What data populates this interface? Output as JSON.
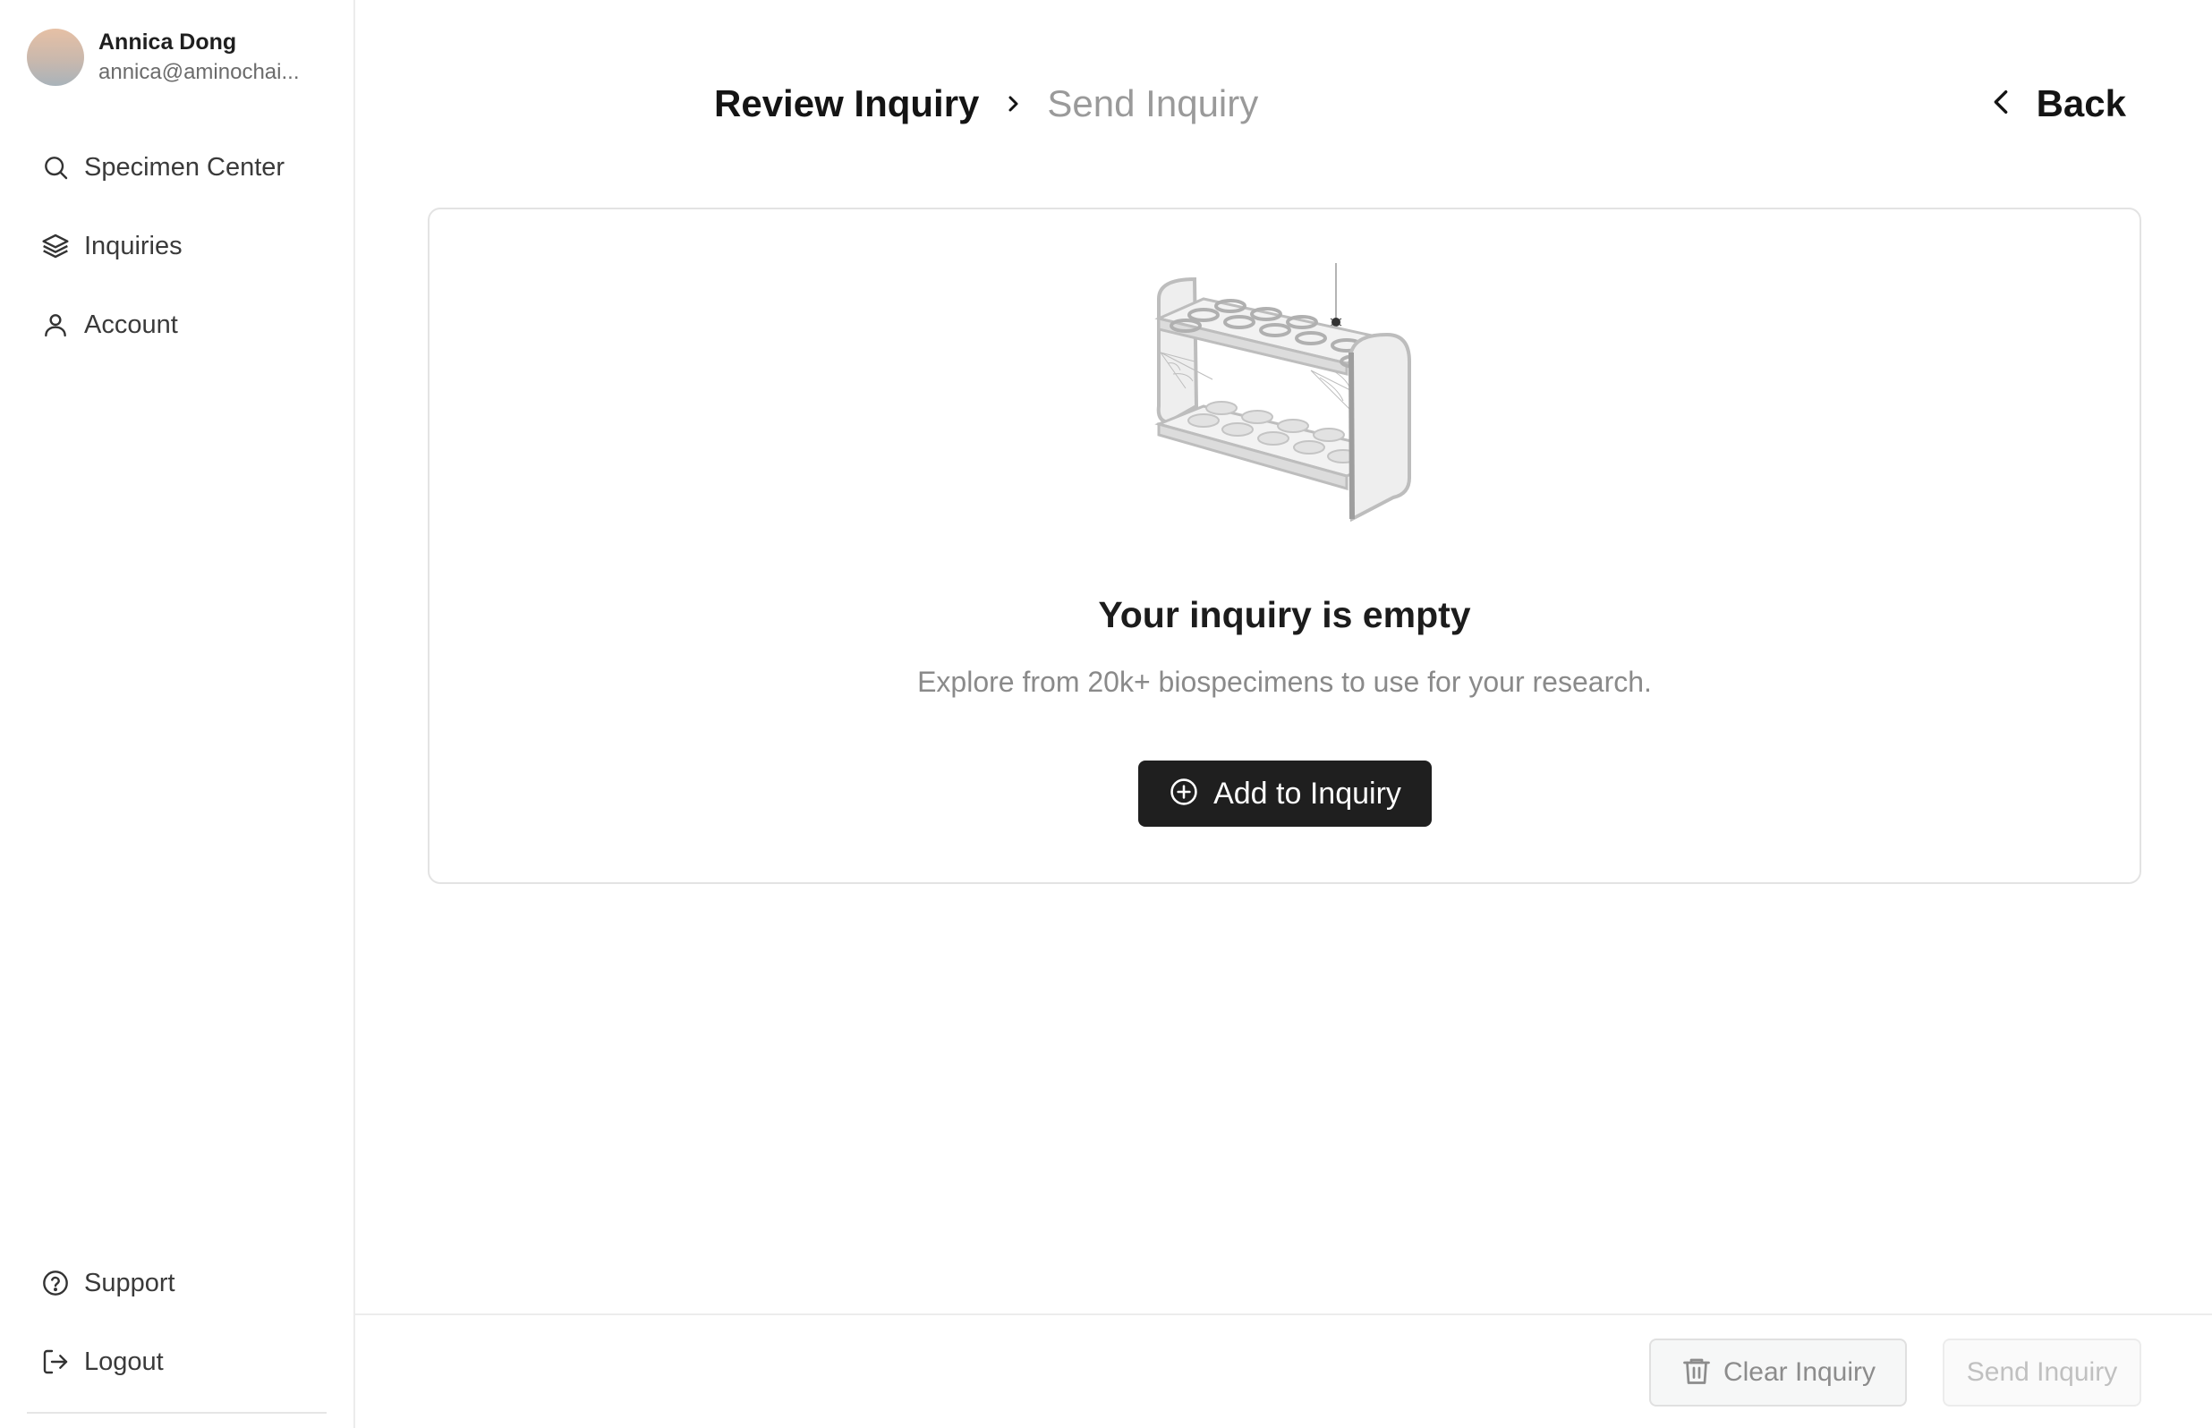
{
  "user": {
    "name": "Annica Dong",
    "email": "annica@aminochai..."
  },
  "sidebar": {
    "items": [
      {
        "label": "Specimen Center",
        "icon": "search-icon"
      },
      {
        "label": "Inquiries",
        "icon": "layers-icon"
      },
      {
        "label": "Account",
        "icon": "user-icon"
      }
    ],
    "bottom_items": [
      {
        "label": "Support",
        "icon": "help-circle-icon"
      },
      {
        "label": "Logout",
        "icon": "logout-icon"
      }
    ]
  },
  "header": {
    "breadcrumb_active": "Review Inquiry",
    "breadcrumb_inactive": "Send Inquiry",
    "back_label": "Back"
  },
  "empty_state": {
    "title": "Your inquiry is empty",
    "description": "Explore from 20k+ biospecimens to use for your research.",
    "button_label": "Add to Inquiry"
  },
  "footer": {
    "clear_label": "Clear Inquiry",
    "send_label": "Send Inquiry"
  },
  "colors": {
    "primary_button": "#1f1f1f",
    "muted_text": "#8a8a8a",
    "border": "#e3e3e3"
  }
}
